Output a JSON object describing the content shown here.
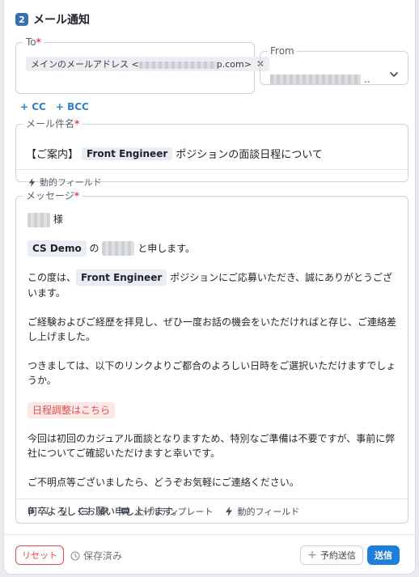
{
  "section": {
    "step": "2",
    "title": "メール通知"
  },
  "to": {
    "label": "To",
    "required_mark": "*",
    "chip_prefix": "メインのメールアドレス <",
    "chip_suffix": "p.com>",
    "chip_close": "✕"
  },
  "from": {
    "label": "From",
    "value_suffix": ".."
  },
  "cc": {
    "cc_label": "+ CC",
    "bcc_label": "+ BCC"
  },
  "subject": {
    "label": "メール件名",
    "required_mark": "*",
    "prefix": "【ご案内】",
    "tag": "Front Engineer",
    "suffix": "ポジションの面談日程について",
    "dynamic_field_label": "動的フィールド"
  },
  "message": {
    "label": "メッセージ",
    "required_mark": "*",
    "line1_suffix": "様",
    "line2_company": "CS Demo",
    "line2_mid": "の",
    "line2_suffix": "と申します。",
    "para3_prefix": "この度は、",
    "para3_tag": "Front Engineer",
    "para3_suffix": "ポジションにご応募いただき、誠にありがとうございます。",
    "para4": "ご経験およびご経歴を拝見し、ぜひ一度お話の機会をいただければと存じ、ご連絡差し上げました。",
    "para5": "つきましては、以下のリンクよりご都合のよろしい日時をご選択いただけますでしょうか。",
    "link_label": "日程調整はこちら",
    "para6": "今回は初回のカジュアル面談となりますため、特別なご準備は不要ですが、事前に弊社についてご確認いただけますと幸いです。",
    "para7": "ご不明点等ございましたら、どうぞお気軽にご連絡ください。",
    "para8": "何卒よろしくお願い申し上げます。"
  },
  "toolbar": {
    "bold": "B",
    "italic": "I",
    "underline": "U",
    "template_label": "メールテンプレート",
    "dynamic_field_label": "動的フィールド"
  },
  "footer": {
    "reset_label": "リセット",
    "saved_label": "保存済み",
    "schedule_label": "予約送信",
    "send_label": "送信"
  },
  "colors": {
    "accent": "#1f7ed8",
    "link": "#2f80c8",
    "danger": "#e5484d",
    "badge": "#3a6fb0"
  }
}
